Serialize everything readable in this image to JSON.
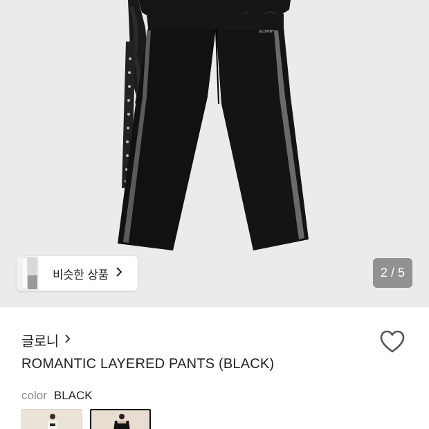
{
  "product_image": {
    "logo_text": "GLOWNY"
  },
  "similar_items": {
    "label": "비슷한 상품",
    "chevron": "chevron-right-icon"
  },
  "pager": {
    "current": 2,
    "total": 5,
    "text": "2 / 5"
  },
  "brand": {
    "name": "글로니",
    "chevron": "chevron-right-icon"
  },
  "wishlist": {
    "icon": "heart-outline-icon"
  },
  "product": {
    "title": "ROMANTIC LAYERED PANTS (BLACK)",
    "color_key": "color",
    "color_value": "BLACK"
  },
  "colors": {
    "background_hero": "#ebebeb",
    "pager_bg": "#7a7a7a",
    "selected_border": "#111111"
  }
}
